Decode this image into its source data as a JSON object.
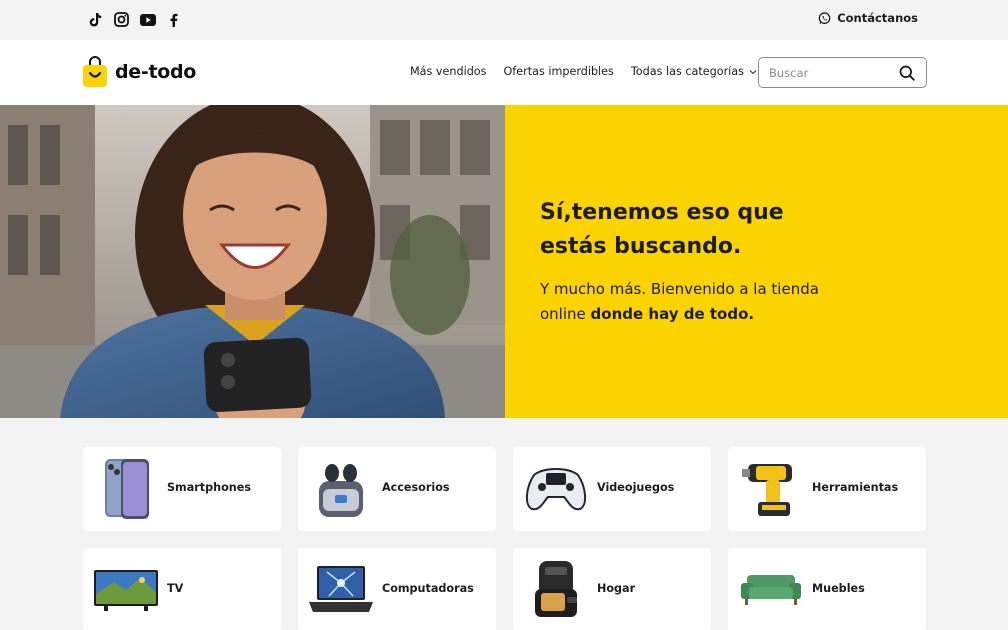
{
  "topbar": {
    "social_icons": [
      "tiktok-icon",
      "instagram-icon",
      "youtube-icon",
      "facebook-icon"
    ],
    "contact_label": "Contáctanos"
  },
  "header": {
    "logo_text": "de-todo",
    "nav": [
      {
        "label": "Más vendidos"
      },
      {
        "label": "Ofertas imperdibles"
      },
      {
        "label": "Todas las categorías"
      }
    ],
    "search_placeholder": "Buscar"
  },
  "hero": {
    "title": "Sí,tenemos eso que estás buscando.",
    "subtitle_plain": "Y mucho más. Bienvenido a la tienda online ",
    "subtitle_bold": "donde hay de todo."
  },
  "categories": [
    {
      "label": "Smartphones",
      "icon": "smartphone-icon"
    },
    {
      "label": "Accesorios",
      "icon": "earbuds-icon"
    },
    {
      "label": "Videojuegos",
      "icon": "gamepad-icon"
    },
    {
      "label": "Herramientas",
      "icon": "power-tool-icon"
    },
    {
      "label": "TV",
      "icon": "tv-icon"
    },
    {
      "label": "Computadoras",
      "icon": "laptop-icon"
    },
    {
      "label": "Hogar",
      "icon": "air-fryer-icon"
    },
    {
      "label": "Muebles",
      "icon": "sofa-icon"
    }
  ],
  "colors": {
    "brand_yellow": "#fbd400",
    "page_bg": "#f3f3f3",
    "text": "#1d1d1d"
  }
}
